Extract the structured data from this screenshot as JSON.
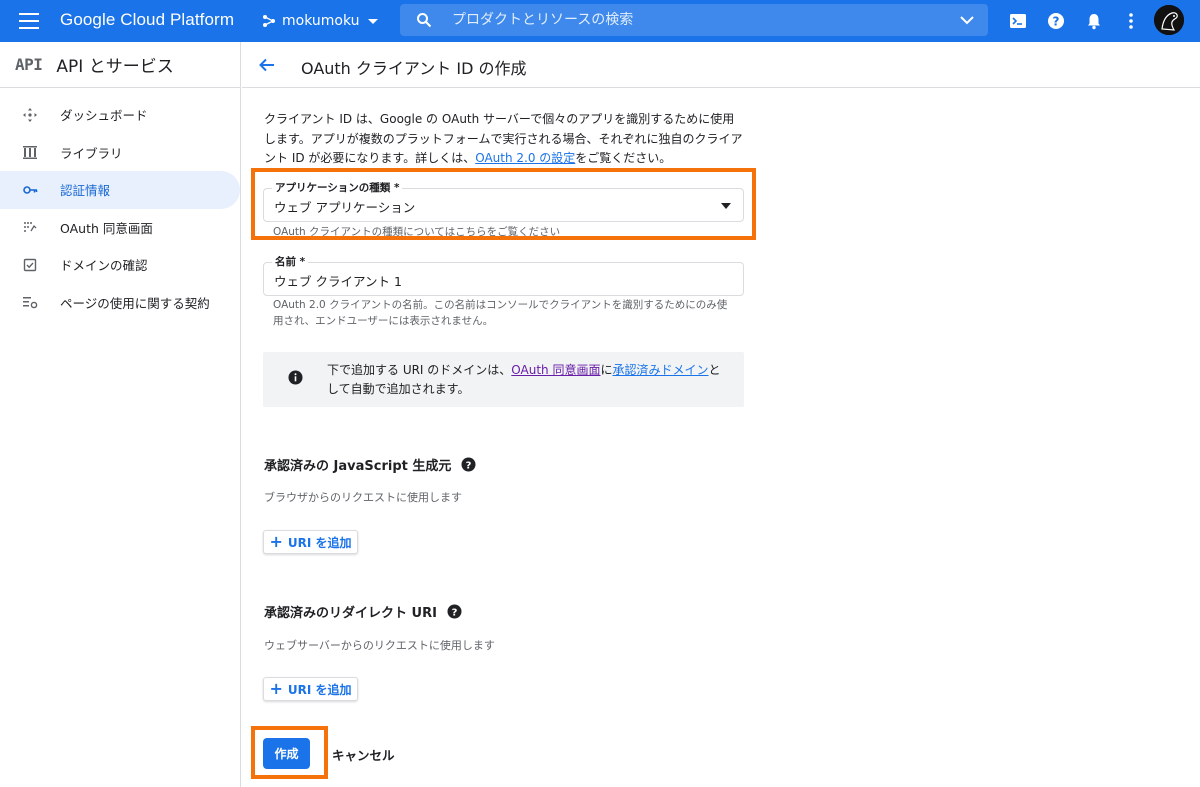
{
  "topbar": {
    "brand": "Google Cloud Platform",
    "project": "mokumoku",
    "search_placeholder": "プロダクトとリソースの検索",
    "icons": [
      "menu-icon",
      "project-icon",
      "search-icon",
      "chevron-down-icon",
      "terminal-icon",
      "help-icon",
      "bell-icon",
      "more-vert-icon",
      "avatar"
    ]
  },
  "sidebar": {
    "logo": "API",
    "title": "API とサービス",
    "items": [
      {
        "label": "ダッシュボード",
        "icon": "dashboard-icon",
        "active": false
      },
      {
        "label": "ライブラリ",
        "icon": "library-icon",
        "active": false
      },
      {
        "label": "認証情報",
        "icon": "key-icon",
        "active": true
      },
      {
        "label": "OAuth 同意画面",
        "icon": "consent-icon",
        "active": false
      },
      {
        "label": "ドメインの確認",
        "icon": "checkbox-icon",
        "active": false
      },
      {
        "label": "ページの使用に関する契約",
        "icon": "settings-list-icon",
        "active": false
      }
    ]
  },
  "header": {
    "title": "OAuth クライアント ID の作成"
  },
  "intro": {
    "text": "クライアント ID は、Google の OAuth サーバーで個々のアプリを識別するために使用します。アプリが複数のプラットフォームで実行される場合、それぞれに独自のクライアント ID が必要になります。詳しくは、",
    "link": "OAuth 2.0 の設定",
    "suffix": "をご覧ください。"
  },
  "app_type": {
    "label": "アプリケーションの種類 *",
    "value": "ウェブ アプリケーション",
    "help_prefix": "OAuth クライアントの種類については",
    "help_link": "こちら",
    "help_suffix": "をご覧ください"
  },
  "name_field": {
    "label": "名前 *",
    "value": "ウェブ クライアント 1",
    "help": "OAuth 2.0 クライアントの名前。この名前はコンソールでクライアントを識別するためにのみ使用され、エンドユーザーには表示されません。"
  },
  "info": {
    "prefix": "下で追加する URI のドメインは、",
    "link1": "OAuth 同意画面",
    "middle": "に",
    "link2": "承認済みドメイン",
    "suffix": "として自動で追加されます。"
  },
  "js_origins": {
    "title": "承認済みの JavaScript 生成元",
    "desc": "ブラウザからのリクエストに使用します",
    "add_label": "URI を追加"
  },
  "redirect_uris": {
    "title": "承認済みのリダイレクト URI",
    "desc": "ウェブサーバーからのリクエストに使用します",
    "add_label": "URI を追加"
  },
  "actions": {
    "create": "作成",
    "cancel": "キャンセル"
  },
  "colors": {
    "brand": "#1a73e8",
    "highlight": "#f5720a",
    "active_nav_bg": "#e8f0fe"
  }
}
